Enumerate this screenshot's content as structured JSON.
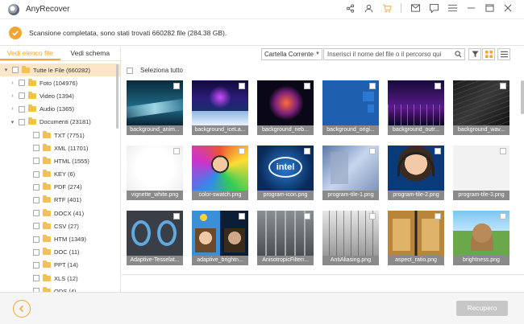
{
  "app": {
    "title": "AnyRecover"
  },
  "status": {
    "message": "Scansione completata, sono stati trovati 660282 file (284.38 GB)."
  },
  "sidebar": {
    "tabs": [
      {
        "label": "Vedi elenco file",
        "active": true
      },
      {
        "label": "Vedi schema",
        "active": false
      }
    ],
    "tree": [
      {
        "label": "Tutte le File (660282)",
        "arrow": "▾",
        "level": 0,
        "selected": true
      },
      {
        "label": "Foto (104976)",
        "arrow": "›",
        "level": 1
      },
      {
        "label": "Video (1394)",
        "arrow": "›",
        "level": 1
      },
      {
        "label": "Audio (1365)",
        "arrow": "›",
        "level": 1
      },
      {
        "label": "Documenti (23181)",
        "arrow": "▾",
        "level": 1
      },
      {
        "label": "TXT (7751)",
        "arrow": "",
        "level": 2
      },
      {
        "label": "XML (11701)",
        "arrow": "",
        "level": 2
      },
      {
        "label": "HTML (1555)",
        "arrow": "",
        "level": 2
      },
      {
        "label": "KEY (6)",
        "arrow": "",
        "level": 2
      },
      {
        "label": "PDF (274)",
        "arrow": "",
        "level": 2
      },
      {
        "label": "RTF (401)",
        "arrow": "",
        "level": 2
      },
      {
        "label": "DOCX (41)",
        "arrow": "",
        "level": 2
      },
      {
        "label": "CSV (27)",
        "arrow": "",
        "level": 2
      },
      {
        "label": "HTM (1349)",
        "arrow": "",
        "level": 2
      },
      {
        "label": "DOC (11)",
        "arrow": "",
        "level": 2
      },
      {
        "label": "PPT (14)",
        "arrow": "",
        "level": 2
      },
      {
        "label": "XLS (12)",
        "arrow": "",
        "level": 2
      },
      {
        "label": "ODS (4)",
        "arrow": "",
        "level": 2
      }
    ]
  },
  "toolbar": {
    "location": "Cartella Corrente",
    "search_placeholder": "Inserisci il nome del file o il percorso qui"
  },
  "main": {
    "select_all_label": "Seleziona tutto",
    "files": [
      {
        "name": "background_anim...",
        "thumb": "bg-anim"
      },
      {
        "name": "background_iceLa...",
        "thumb": "bg-ice"
      },
      {
        "name": "background_neb...",
        "thumb": "bg-neb"
      },
      {
        "name": "background_origi...",
        "thumb": "bg-orig"
      },
      {
        "name": "background_outr...",
        "thumb": "bg-outr"
      },
      {
        "name": "background_wav...",
        "thumb": "bg-wav"
      },
      {
        "name": "vignette_white.png",
        "thumb": "vignette"
      },
      {
        "name": "color-swatch.png",
        "thumb": "swatch"
      },
      {
        "name": "program-icon.png",
        "thumb": "intel"
      },
      {
        "name": "program-tile-1.png",
        "thumb": "tile1"
      },
      {
        "name": "program-tile-2.png",
        "thumb": "tile2"
      },
      {
        "name": "program-tile-3.png",
        "thumb": "tile3"
      },
      {
        "name": "Adaptive-Tesselat...",
        "thumb": "tess"
      },
      {
        "name": "adaptive_brightn...",
        "thumb": "bright"
      },
      {
        "name": "AnisotropicFilteri...",
        "thumb": "aniso"
      },
      {
        "name": "AntiAliasing.png",
        "thumb": "aa"
      },
      {
        "name": "aspect_ratio.png",
        "thumb": "aspect"
      },
      {
        "name": "brightness.png",
        "thumb": "dog"
      }
    ]
  },
  "footer": {
    "recover_label": "Recupero"
  },
  "colors": {
    "accent": "#f2a533",
    "label_bg": "#8a8a8a",
    "disabled_button": "#c7c7c7"
  }
}
